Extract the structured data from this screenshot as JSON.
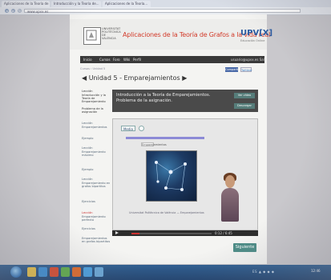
{
  "browser": {
    "tabs": [
      "Aplicaciones de la Teoría de Grafos",
      "Introducción y la Teoría de...",
      "Aplicaciones de la Teoría..."
    ],
    "url": "www.upvx.es"
  },
  "site": {
    "university": "UNIVERSITAT POLITÈCNICA DE VALÈNCIA",
    "title": "Aplicaciones de la Teoría de Grafos a la vida real",
    "brand": "UPV[X]",
    "brand_sub": "Educación Online"
  },
  "nav": {
    "items": [
      "Inicio",
      "Cursos",
      "Foro",
      "Wiki",
      "Perfil"
    ],
    "user": "usuario@upvx.es  Salir"
  },
  "breadcrumb": "Cursos › Unidad 5",
  "social": {
    "share": "Compartir",
    "tweet": "Twittear"
  },
  "unit_title": "Unidad 5 - Emparejamientos",
  "sidebar": [
    "Lección",
    "Introducción y la Teoría de Emparejamiento",
    "Problema de la asignación",
    "Lección",
    "Emparejamientos",
    "Ejemplo",
    "Lección",
    "Emparejamiento máximo",
    "Ejemplo",
    "Lección",
    "Emparejamiento en grafos bipartitos",
    "Ejercicios",
    "Lección",
    "Emparejamiento perfecto",
    "Ejercicios",
    "Emparejamientos en grafos bipartitos"
  ],
  "lesson": {
    "title": "Introducción a la Teoría de Emparejamientos. Problema de la asignación.",
    "buttons": [
      "Ver vídeo",
      "Descargar"
    ]
  },
  "player": {
    "media_tab": "Media",
    "slide_button": "Emparejamientos",
    "caption": "Universitat Politècnica de València — Emparejamientos",
    "time": "0:12 / 6:45",
    "progress": 0.1
  },
  "next_button": "Siguiente",
  "taskbar": {
    "tray": "ES  ▲  ◆  ◆  ◆",
    "clock": "12:46"
  },
  "colors": {
    "site_title": "#d23b2a",
    "brand": "#2a5aa0",
    "next_button": "#4d8c86",
    "taskbar": "#2f5f92"
  }
}
